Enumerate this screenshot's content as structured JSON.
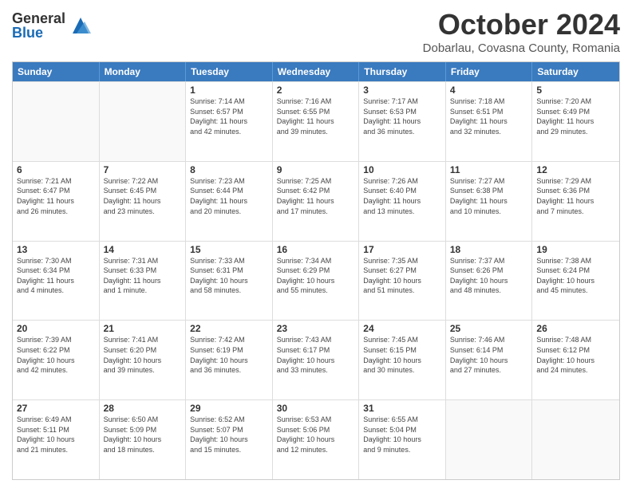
{
  "header": {
    "logo_general": "General",
    "logo_blue": "Blue",
    "title": "October 2024",
    "subtitle": "Dobarlau, Covasna County, Romania"
  },
  "days_of_week": [
    "Sunday",
    "Monday",
    "Tuesday",
    "Wednesday",
    "Thursday",
    "Friday",
    "Saturday"
  ],
  "weeks": [
    [
      {
        "day": "",
        "lines": []
      },
      {
        "day": "",
        "lines": []
      },
      {
        "day": "1",
        "lines": [
          "Sunrise: 7:14 AM",
          "Sunset: 6:57 PM",
          "Daylight: 11 hours",
          "and 42 minutes."
        ]
      },
      {
        "day": "2",
        "lines": [
          "Sunrise: 7:16 AM",
          "Sunset: 6:55 PM",
          "Daylight: 11 hours",
          "and 39 minutes."
        ]
      },
      {
        "day": "3",
        "lines": [
          "Sunrise: 7:17 AM",
          "Sunset: 6:53 PM",
          "Daylight: 11 hours",
          "and 36 minutes."
        ]
      },
      {
        "day": "4",
        "lines": [
          "Sunrise: 7:18 AM",
          "Sunset: 6:51 PM",
          "Daylight: 11 hours",
          "and 32 minutes."
        ]
      },
      {
        "day": "5",
        "lines": [
          "Sunrise: 7:20 AM",
          "Sunset: 6:49 PM",
          "Daylight: 11 hours",
          "and 29 minutes."
        ]
      }
    ],
    [
      {
        "day": "6",
        "lines": [
          "Sunrise: 7:21 AM",
          "Sunset: 6:47 PM",
          "Daylight: 11 hours",
          "and 26 minutes."
        ]
      },
      {
        "day": "7",
        "lines": [
          "Sunrise: 7:22 AM",
          "Sunset: 6:45 PM",
          "Daylight: 11 hours",
          "and 23 minutes."
        ]
      },
      {
        "day": "8",
        "lines": [
          "Sunrise: 7:23 AM",
          "Sunset: 6:44 PM",
          "Daylight: 11 hours",
          "and 20 minutes."
        ]
      },
      {
        "day": "9",
        "lines": [
          "Sunrise: 7:25 AM",
          "Sunset: 6:42 PM",
          "Daylight: 11 hours",
          "and 17 minutes."
        ]
      },
      {
        "day": "10",
        "lines": [
          "Sunrise: 7:26 AM",
          "Sunset: 6:40 PM",
          "Daylight: 11 hours",
          "and 13 minutes."
        ]
      },
      {
        "day": "11",
        "lines": [
          "Sunrise: 7:27 AM",
          "Sunset: 6:38 PM",
          "Daylight: 11 hours",
          "and 10 minutes."
        ]
      },
      {
        "day": "12",
        "lines": [
          "Sunrise: 7:29 AM",
          "Sunset: 6:36 PM",
          "Daylight: 11 hours",
          "and 7 minutes."
        ]
      }
    ],
    [
      {
        "day": "13",
        "lines": [
          "Sunrise: 7:30 AM",
          "Sunset: 6:34 PM",
          "Daylight: 11 hours",
          "and 4 minutes."
        ]
      },
      {
        "day": "14",
        "lines": [
          "Sunrise: 7:31 AM",
          "Sunset: 6:33 PM",
          "Daylight: 11 hours",
          "and 1 minute."
        ]
      },
      {
        "day": "15",
        "lines": [
          "Sunrise: 7:33 AM",
          "Sunset: 6:31 PM",
          "Daylight: 10 hours",
          "and 58 minutes."
        ]
      },
      {
        "day": "16",
        "lines": [
          "Sunrise: 7:34 AM",
          "Sunset: 6:29 PM",
          "Daylight: 10 hours",
          "and 55 minutes."
        ]
      },
      {
        "day": "17",
        "lines": [
          "Sunrise: 7:35 AM",
          "Sunset: 6:27 PM",
          "Daylight: 10 hours",
          "and 51 minutes."
        ]
      },
      {
        "day": "18",
        "lines": [
          "Sunrise: 7:37 AM",
          "Sunset: 6:26 PM",
          "Daylight: 10 hours",
          "and 48 minutes."
        ]
      },
      {
        "day": "19",
        "lines": [
          "Sunrise: 7:38 AM",
          "Sunset: 6:24 PM",
          "Daylight: 10 hours",
          "and 45 minutes."
        ]
      }
    ],
    [
      {
        "day": "20",
        "lines": [
          "Sunrise: 7:39 AM",
          "Sunset: 6:22 PM",
          "Daylight: 10 hours",
          "and 42 minutes."
        ]
      },
      {
        "day": "21",
        "lines": [
          "Sunrise: 7:41 AM",
          "Sunset: 6:20 PM",
          "Daylight: 10 hours",
          "and 39 minutes."
        ]
      },
      {
        "day": "22",
        "lines": [
          "Sunrise: 7:42 AM",
          "Sunset: 6:19 PM",
          "Daylight: 10 hours",
          "and 36 minutes."
        ]
      },
      {
        "day": "23",
        "lines": [
          "Sunrise: 7:43 AM",
          "Sunset: 6:17 PM",
          "Daylight: 10 hours",
          "and 33 minutes."
        ]
      },
      {
        "day": "24",
        "lines": [
          "Sunrise: 7:45 AM",
          "Sunset: 6:15 PM",
          "Daylight: 10 hours",
          "and 30 minutes."
        ]
      },
      {
        "day": "25",
        "lines": [
          "Sunrise: 7:46 AM",
          "Sunset: 6:14 PM",
          "Daylight: 10 hours",
          "and 27 minutes."
        ]
      },
      {
        "day": "26",
        "lines": [
          "Sunrise: 7:48 AM",
          "Sunset: 6:12 PM",
          "Daylight: 10 hours",
          "and 24 minutes."
        ]
      }
    ],
    [
      {
        "day": "27",
        "lines": [
          "Sunrise: 6:49 AM",
          "Sunset: 5:11 PM",
          "Daylight: 10 hours",
          "and 21 minutes."
        ]
      },
      {
        "day": "28",
        "lines": [
          "Sunrise: 6:50 AM",
          "Sunset: 5:09 PM",
          "Daylight: 10 hours",
          "and 18 minutes."
        ]
      },
      {
        "day": "29",
        "lines": [
          "Sunrise: 6:52 AM",
          "Sunset: 5:07 PM",
          "Daylight: 10 hours",
          "and 15 minutes."
        ]
      },
      {
        "day": "30",
        "lines": [
          "Sunrise: 6:53 AM",
          "Sunset: 5:06 PM",
          "Daylight: 10 hours",
          "and 12 minutes."
        ]
      },
      {
        "day": "31",
        "lines": [
          "Sunrise: 6:55 AM",
          "Sunset: 5:04 PM",
          "Daylight: 10 hours",
          "and 9 minutes."
        ]
      },
      {
        "day": "",
        "lines": []
      },
      {
        "day": "",
        "lines": []
      }
    ]
  ]
}
